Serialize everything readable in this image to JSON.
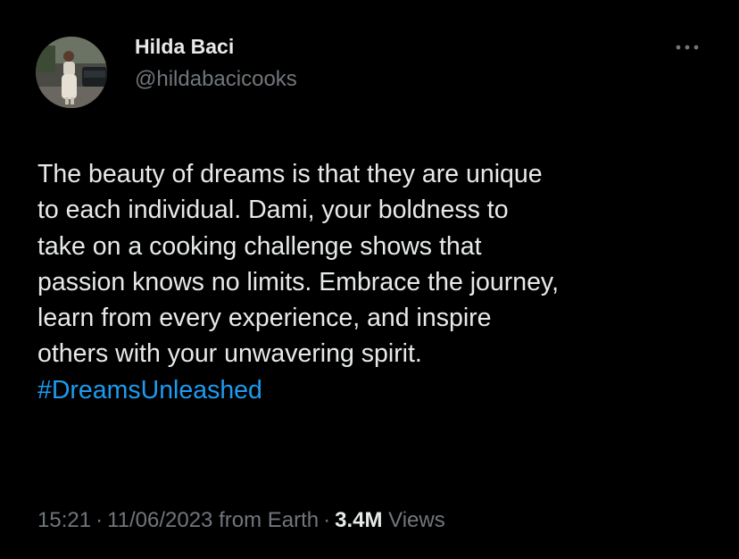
{
  "author": {
    "display_name": "Hilda Baci",
    "handle": "@hildabacicooks"
  },
  "tweet": {
    "lines": [
      "The beauty of dreams is that they are unique",
      "to each individual. Dami, your boldness to",
      "take on a cooking challenge shows that",
      "passion knows no limits. Embrace the journey,",
      "learn from every experience, and inspire",
      "others with your unwavering spirit."
    ],
    "hashtag": "#DreamsUnleashed"
  },
  "meta": {
    "time": "15:21",
    "separator": "·",
    "date": "11/06/2023",
    "source": "from Earth",
    "views_count": "3.4M",
    "views_label": "Views"
  },
  "colors": {
    "background": "#000000",
    "primary_text": "#e7e9ea",
    "secondary_text": "#71767b",
    "link": "#1d9bf0"
  },
  "icons": {
    "more": "more-horizontal-icon"
  }
}
